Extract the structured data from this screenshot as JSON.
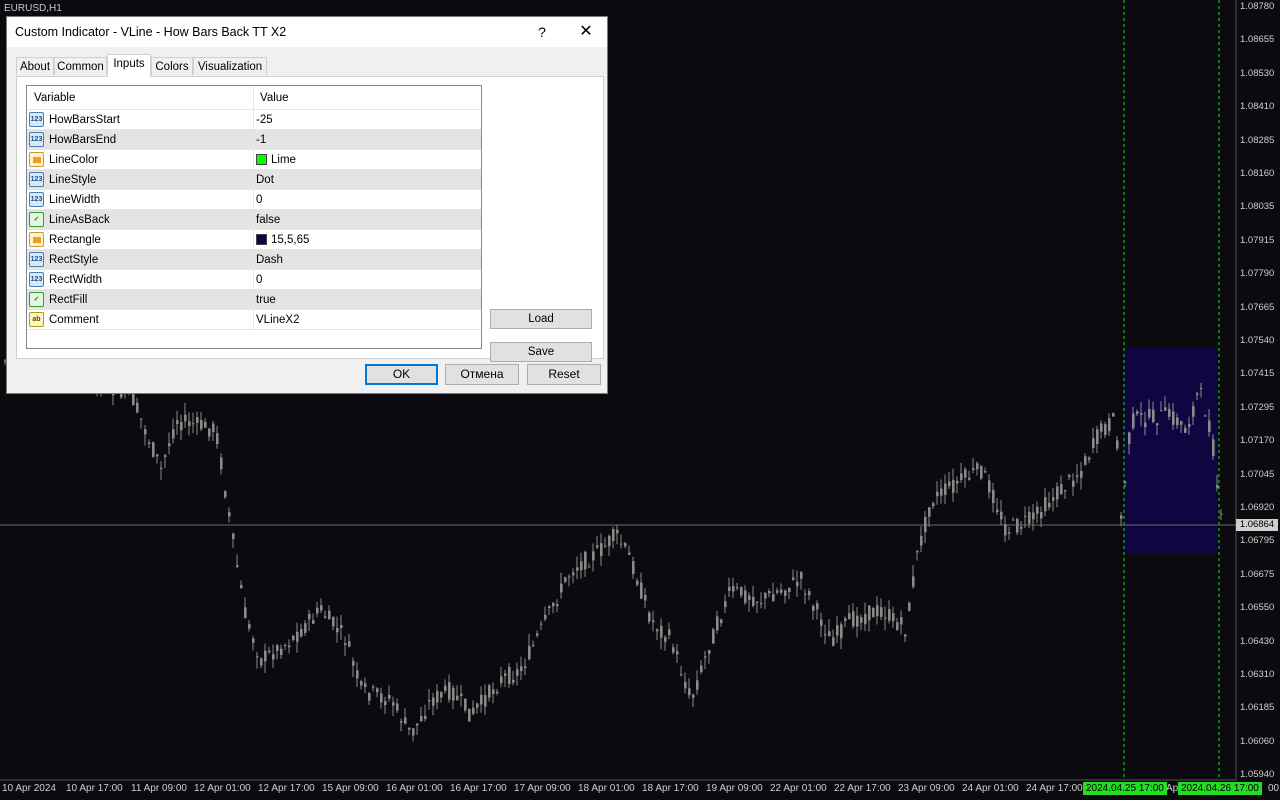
{
  "chart": {
    "symbol": "EURUSD,H1",
    "price_labels": [
      "1.08780",
      "1.08655",
      "1.08530",
      "1.08410",
      "1.08285",
      "1.08160",
      "1.08035",
      "1.07915",
      "1.07790",
      "1.07665",
      "1.07540",
      "1.07415",
      "1.07295",
      "1.07170",
      "1.07045",
      "1.06920",
      "1.06795",
      "1.06675",
      "1.06550",
      "1.06430",
      "1.06310",
      "1.06185",
      "1.06060",
      "1.05940"
    ],
    "current_price": "1.06864",
    "time_labels": [
      "10 Apr 2024",
      "10 Apr 17:00",
      "11 Apr 09:00",
      "12 Apr 01:00",
      "12 Apr 17:00",
      "15 Apr 09:00",
      "16 Apr 01:00",
      "16 Apr 17:00",
      "17 Apr 09:00",
      "18 Apr 01:00",
      "18 Apr 17:00",
      "19 Apr 09:00",
      "22 Apr 01:00",
      "22 Apr 17:00",
      "23 Apr 09:00",
      "24 Apr 01:00",
      "24 Apr 17:00",
      "Ap",
      "00"
    ],
    "vline_tags": [
      "2024.04.25 17:00",
      "2024.04.26 17:00"
    ],
    "colors": {
      "background": "#0b0b0f",
      "candle": "#8a8a8a",
      "vline": "#22dd22",
      "rectangle": "#0f0541"
    }
  },
  "dialog": {
    "title": "Custom Indicator - VLine - How Bars Back TT X2",
    "help_label": "?",
    "close_label": "✕",
    "tabs": [
      "About",
      "Common",
      "Inputs",
      "Colors",
      "Visualization"
    ],
    "active_tab": "Inputs",
    "grid": {
      "headers": {
        "variable": "Variable",
        "value": "Value"
      },
      "rows": [
        {
          "icon": "num",
          "name": "HowBarsStart",
          "value": "-25"
        },
        {
          "icon": "num",
          "name": "HowBarsEnd",
          "value": "-1"
        },
        {
          "icon": "clr",
          "name": "LineColor",
          "value": "Lime",
          "swatch": "#00ff00"
        },
        {
          "icon": "num",
          "name": "LineStyle",
          "value": "Dot"
        },
        {
          "icon": "num",
          "name": "LineWidth",
          "value": "0"
        },
        {
          "icon": "bool",
          "name": "LineAsBack",
          "value": "false"
        },
        {
          "icon": "clr",
          "name": "Rectangle",
          "value": "15,5,65",
          "swatch": "#0f0541"
        },
        {
          "icon": "num",
          "name": "RectStyle",
          "value": "Dash"
        },
        {
          "icon": "num",
          "name": "RectWidth",
          "value": "0"
        },
        {
          "icon": "bool",
          "name": "RectFill",
          "value": "true"
        },
        {
          "icon": "str",
          "name": "Comment",
          "value": "VLineX2"
        }
      ]
    },
    "load_label": "Load",
    "save_label": "Save",
    "ok_label": "OK",
    "cancel_label": "Отмена",
    "reset_label": "Reset"
  }
}
